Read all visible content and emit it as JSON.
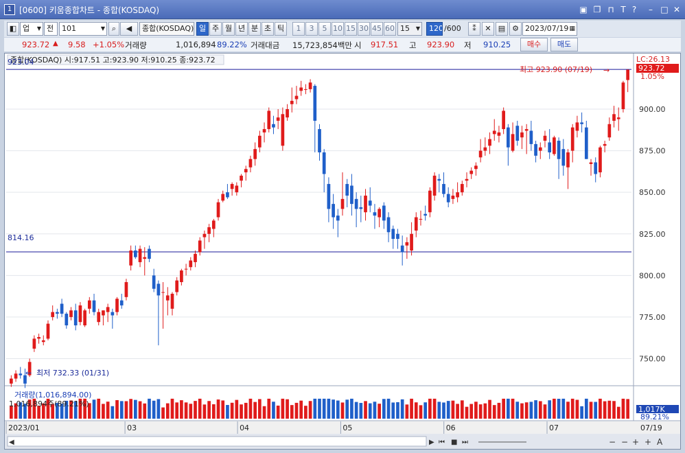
{
  "window": {
    "number": "1",
    "title": "[0600] 키움종합차트 - 종합(KOSDAQ)"
  },
  "toolbar": {
    "market": "업",
    "scope": "전",
    "code": "101",
    "name": "종합(KOSDAQ)",
    "period_buttons": [
      "일",
      "주",
      "월",
      "년",
      "분",
      "초",
      "틱"
    ],
    "active_period": "일",
    "interval_buttons": [
      "1",
      "3",
      "5",
      "10",
      "15",
      "30",
      "45",
      "60"
    ],
    "interval_select": "15",
    "count_value": "120",
    "count_total": "/600",
    "date": "2023/07/19"
  },
  "quote": {
    "price": "923.72",
    "change": "9.58",
    "change_pct": "+1.05%",
    "volume_label": "거래량",
    "volume": "1,016,894",
    "volume_pct": "89.22%",
    "amount_label": "거래대금",
    "amount": "15,723,854백만",
    "open_label": "시",
    "open": "917.51",
    "high_label": "고",
    "high": "923.90",
    "low_label": "저",
    "low": "910.25",
    "buy_label": "매수",
    "sell_label": "매도"
  },
  "chart": {
    "legend": "종합(KOSDAQ) 시:917.51 고:923.90 저:910.25 종:923.72",
    "lc_label": "LC:26.13",
    "top_label": "923.04",
    "price_tag": "923.72",
    "price_pct_tag": "1.05%",
    "hline_label": "814.16",
    "high_annotation": "최고 923.90 (07/19)",
    "low_annotation": "최저 732.33 (01/31)",
    "volume_legend": "거래량(1,016,894.00)",
    "volume_info": "1,016,894주(89.21%)",
    "volume_tag": "1,017K",
    "volume_pct_tag": "89.21%",
    "date_right": "07/19"
  },
  "chart_data": {
    "type": "candlestick",
    "y_axis_ticks": [
      "900.00",
      "875.00",
      "850.00",
      "825.00",
      "800.00",
      "775.00",
      "750.00"
    ],
    "ylim": [
      737,
      926
    ],
    "x_axis_labels": [
      "2023/01",
      "03",
      "04",
      "05",
      "06",
      "07"
    ],
    "horizontal_lines": [
      814.16
    ],
    "max": {
      "value": 923.9,
      "date": "07/19"
    },
    "min": {
      "value": 732.33,
      "date": "01/31"
    },
    "candles": [
      [
        735,
        740,
        733,
        738
      ],
      [
        738,
        743,
        736,
        741
      ],
      [
        741,
        745,
        738,
        740
      ],
      [
        740,
        744,
        732.33,
        735
      ],
      [
        740,
        750,
        739,
        748
      ],
      [
        756,
        764,
        754,
        762
      ],
      [
        762,
        765,
        759,
        763
      ],
      [
        760,
        764,
        758,
        761
      ],
      [
        762,
        773,
        761,
        771
      ],
      [
        775,
        782,
        773,
        778
      ],
      [
        778,
        780,
        774,
        777
      ],
      [
        783,
        786,
        775,
        777
      ],
      [
        777,
        778,
        768,
        770
      ],
      [
        775,
        781,
        773,
        779
      ],
      [
        779,
        783,
        767,
        770
      ],
      [
        772,
        784,
        770,
        782
      ],
      [
        770,
        780,
        769,
        779
      ],
      [
        780,
        787,
        777,
        785
      ],
      [
        785,
        789,
        776,
        778
      ],
      [
        772,
        780,
        770,
        778
      ],
      [
        776,
        779,
        770,
        779
      ],
      [
        778,
        783,
        772,
        781
      ],
      [
        778,
        780,
        768,
        776
      ],
      [
        778,
        787,
        776,
        786
      ],
      [
        785,
        789,
        780,
        782
      ],
      [
        787,
        798,
        785,
        796
      ],
      [
        806,
        818,
        803,
        815
      ],
      [
        815,
        818,
        810,
        811
      ],
      [
        808,
        818,
        805,
        816
      ],
      [
        810,
        817,
        800,
        811
      ],
      [
        816,
        818,
        808,
        810
      ],
      [
        800,
        804,
        790,
        792
      ],
      [
        795,
        797,
        758,
        788
      ],
      [
        790,
        796,
        768,
        790
      ],
      [
        785,
        793,
        776,
        788
      ],
      [
        780,
        790,
        776,
        789
      ],
      [
        790,
        799,
        788,
        797
      ],
      [
        796,
        804,
        794,
        803
      ],
      [
        804,
        807,
        800,
        804
      ],
      [
        805,
        811,
        803,
        809
      ],
      [
        808,
        815,
        805,
        813
      ],
      [
        814,
        823,
        812,
        821
      ],
      [
        823,
        827,
        816,
        825
      ],
      [
        825,
        831,
        820,
        829
      ],
      [
        828,
        834,
        823,
        833
      ],
      [
        835,
        846,
        833,
        844
      ],
      [
        845,
        851,
        844,
        849
      ],
      [
        850,
        855,
        846,
        847
      ],
      [
        852,
        856,
        848,
        855
      ],
      [
        850,
        856,
        848,
        854
      ],
      [
        857,
        861,
        853,
        860
      ],
      [
        862,
        866,
        857,
        864
      ],
      [
        865,
        872,
        862,
        870
      ],
      [
        870,
        880,
        866,
        876
      ],
      [
        877,
        887,
        874,
        884
      ],
      [
        886,
        892,
        880,
        888
      ],
      [
        888,
        901,
        886,
        899
      ],
      [
        891,
        896,
        885,
        889
      ],
      [
        893,
        900,
        888,
        895
      ],
      [
        878,
        901,
        875,
        897
      ],
      [
        895,
        903,
        893,
        900
      ],
      [
        903,
        913,
        898,
        905
      ],
      [
        906,
        914,
        903,
        908
      ],
      [
        911,
        917,
        908,
        913
      ],
      [
        912,
        915,
        909,
        912
      ],
      [
        912,
        918,
        910,
        916
      ],
      [
        914,
        915,
        874,
        893
      ],
      [
        888,
        891,
        869,
        874
      ],
      [
        874,
        876,
        850,
        861
      ],
      [
        855,
        859,
        832,
        840
      ],
      [
        843,
        849,
        828,
        835
      ],
      [
        836,
        840,
        823,
        833
      ],
      [
        840,
        862,
        836,
        846
      ],
      [
        855,
        858,
        841,
        848
      ],
      [
        854,
        861,
        836,
        843
      ],
      [
        846,
        850,
        829,
        840
      ],
      [
        841,
        848,
        832,
        840
      ],
      [
        838,
        852,
        833,
        848
      ],
      [
        845,
        853,
        838,
        842
      ],
      [
        838,
        843,
        828,
        836
      ],
      [
        835,
        841,
        829,
        840
      ],
      [
        842,
        844,
        828,
        833
      ],
      [
        835,
        838,
        820,
        826
      ],
      [
        828,
        830,
        816,
        822
      ],
      [
        825,
        828,
        816,
        822
      ],
      [
        818,
        824,
        806,
        814
      ],
      [
        818,
        823,
        810,
        820
      ],
      [
        815,
        832,
        812,
        825
      ],
      [
        827,
        838,
        823,
        835
      ],
      [
        834,
        839,
        830,
        834
      ],
      [
        837,
        842,
        833,
        836
      ],
      [
        838,
        853,
        835,
        851
      ],
      [
        848,
        862,
        845,
        860
      ],
      [
        858,
        861,
        850,
        857
      ],
      [
        855,
        862,
        847,
        849
      ],
      [
        849,
        853,
        841,
        844
      ],
      [
        846,
        852,
        843,
        848
      ],
      [
        847,
        856,
        844,
        850
      ],
      [
        850,
        857,
        848,
        855
      ],
      [
        857,
        862,
        853,
        858
      ],
      [
        861,
        865,
        858,
        863
      ],
      [
        864,
        868,
        860,
        866
      ],
      [
        871,
        882,
        868,
        875
      ],
      [
        875,
        883,
        872,
        877
      ],
      [
        878,
        886,
        873,
        882
      ],
      [
        885,
        894,
        881,
        887
      ],
      [
        884,
        890,
        880,
        886
      ],
      [
        888,
        901,
        885,
        899
      ],
      [
        889,
        891,
        866,
        877
      ],
      [
        875,
        892,
        874,
        885
      ],
      [
        890,
        893,
        878,
        881
      ],
      [
        883,
        890,
        876,
        886
      ],
      [
        887,
        891,
        873,
        888
      ],
      [
        887,
        893,
        875,
        879
      ],
      [
        879,
        881,
        868,
        872
      ],
      [
        875,
        880,
        870,
        877
      ],
      [
        881,
        887,
        877,
        884
      ],
      [
        880,
        888,
        870,
        874
      ],
      [
        873,
        884,
        872,
        883
      ],
      [
        881,
        883,
        858,
        870
      ],
      [
        876,
        882,
        860,
        866
      ],
      [
        865,
        876,
        852,
        874
      ],
      [
        875,
        891,
        868,
        889
      ],
      [
        887,
        896,
        883,
        892
      ],
      [
        892,
        898,
        886,
        891
      ],
      [
        889,
        893,
        870,
        870
      ],
      [
        867,
        870,
        860,
        868
      ],
      [
        868,
        871,
        856,
        861
      ],
      [
        862,
        878,
        859,
        877
      ],
      [
        878,
        881,
        874,
        879
      ],
      [
        883,
        895,
        881,
        891
      ],
      [
        893,
        902,
        889,
        897
      ],
      [
        894,
        901,
        887,
        895
      ],
      [
        900,
        917,
        898,
        916
      ],
      [
        917.51,
        923.9,
        910.25,
        923.72
      ]
    ],
    "volume_max": 1250000
  }
}
